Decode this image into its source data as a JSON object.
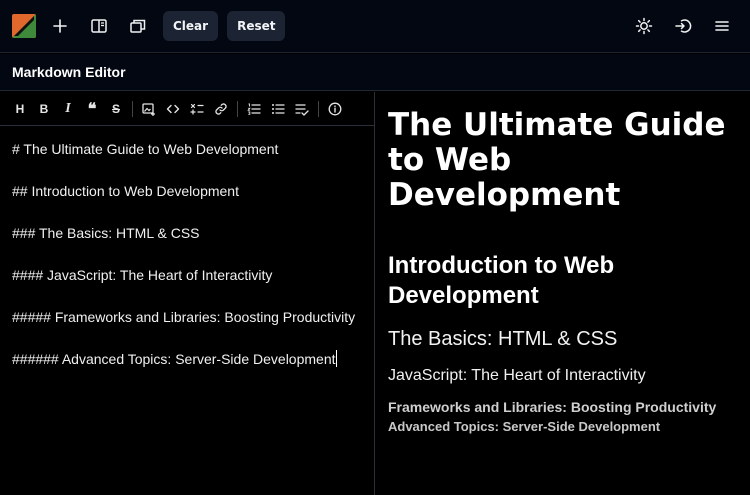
{
  "toolbar": {
    "clear_label": "Clear",
    "reset_label": "Reset",
    "icons": [
      "logo",
      "plus-icon",
      "split-view-icon",
      "windows-icon",
      "sun-icon",
      "sign-in-icon",
      "menu-icon"
    ]
  },
  "header": {
    "title": "Markdown Editor"
  },
  "format_toolbar": {
    "buttons": [
      "heading",
      "bold",
      "italic",
      "quote",
      "strikethrough",
      "image",
      "code",
      "math",
      "link",
      "ordered-list",
      "unordered-list",
      "task-list",
      "info"
    ]
  },
  "editor": {
    "lines": [
      "# The Ultimate Guide to Web Development",
      "## Introduction to Web Development",
      "### The Basics: HTML & CSS",
      "#### JavaScript: The Heart of Interactivity",
      "##### Frameworks and Libraries: Boosting Productivity",
      "###### Advanced Topics: Server-Side Development"
    ]
  },
  "preview": {
    "h1": "The Ultimate Guide to Web Development",
    "h2": "Introduction to Web Development",
    "h3": "The Basics: HTML & CSS",
    "h4": "JavaScript: The Heart of Interactivity",
    "h5": "Frameworks and Libraries: Boosting Productivity",
    "h6": "Advanced Topics: Server-Side Development"
  },
  "colors": {
    "topbar_bg": "#030712",
    "pill_bg": "#1c2333",
    "panel_bg": "#000000"
  }
}
